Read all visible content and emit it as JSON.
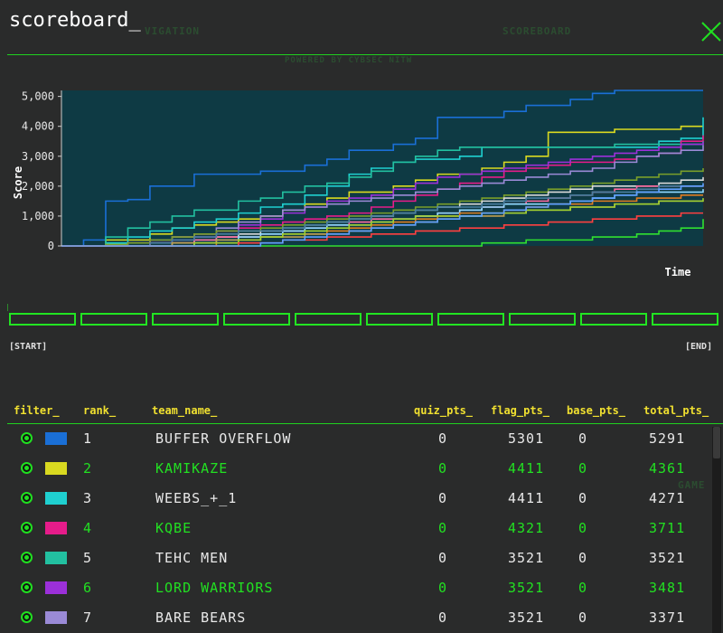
{
  "window": {
    "title": "scoreboard_"
  },
  "background": {
    "nav_label": "VIGATION",
    "scoreboard_label": "SCOREBOARD",
    "powered_by": "POWERED BY CYBSEC NITW",
    "game_label": "GAME"
  },
  "timeline": {
    "start_label": "[START]",
    "end_label": "[END]"
  },
  "chart_data": {
    "type": "line",
    "ylabel": "Score",
    "xlabel": "Time",
    "ylim": [
      0,
      5200
    ],
    "yticks": [
      "0",
      "1,000",
      "2,000",
      "3,000",
      "4,000",
      "5,000"
    ],
    "x_steps": 30,
    "series": [
      {
        "color": "#1a6fd6",
        "values": [
          0,
          200,
          1500,
          1550,
          2000,
          2000,
          2400,
          2400,
          2400,
          2500,
          2500,
          2700,
          2900,
          3200,
          3200,
          3400,
          3600,
          4300,
          4300,
          4300,
          4500,
          4700,
          4700,
          4900,
          5100,
          5200,
          5200,
          5200,
          5200,
          5200
        ]
      },
      {
        "color": "#d9d920",
        "values": [
          0,
          0,
          200,
          200,
          400,
          600,
          700,
          800,
          900,
          1000,
          1200,
          1400,
          1600,
          1800,
          1800,
          2000,
          2200,
          2400,
          2400,
          2600,
          2800,
          3000,
          3800,
          3800,
          3800,
          3900,
          3900,
          3900,
          4000,
          4000
        ]
      },
      {
        "color": "#1fd0d0",
        "values": [
          0,
          0,
          100,
          300,
          500,
          600,
          800,
          900,
          1100,
          1300,
          1400,
          1700,
          2000,
          2400,
          2600,
          2800,
          2900,
          2900,
          3000,
          3300,
          3300,
          3300,
          3300,
          3300,
          3300,
          3300,
          3300,
          3500,
          3600,
          4300
        ]
      },
      {
        "color": "#e61c8a",
        "values": [
          0,
          0,
          0,
          100,
          200,
          300,
          400,
          500,
          600,
          700,
          800,
          900,
          1000,
          1100,
          1300,
          1500,
          1700,
          1900,
          2100,
          2300,
          2500,
          2600,
          2700,
          2800,
          2800,
          2900,
          3000,
          3100,
          3500,
          3700
        ]
      },
      {
        "color": "#22c0a0",
        "values": [
          0,
          0,
          300,
          600,
          800,
          1000,
          1200,
          1200,
          1500,
          1600,
          1800,
          2000,
          2100,
          2300,
          2500,
          2800,
          3000,
          3200,
          3300,
          3300,
          3300,
          3300,
          3300,
          3300,
          3300,
          3400,
          3400,
          3400,
          3400,
          3500
        ]
      },
      {
        "color": "#9b30d9",
        "values": [
          0,
          0,
          0,
          0,
          100,
          200,
          300,
          500,
          700,
          900,
          1100,
          1300,
          1500,
          1600,
          1700,
          1900,
          2100,
          2300,
          2400,
          2500,
          2600,
          2700,
          2800,
          2900,
          3000,
          3100,
          3200,
          3300,
          3400,
          3480
        ]
      },
      {
        "color": "#9a8ad6",
        "values": [
          0,
          0,
          0,
          100,
          200,
          300,
          400,
          600,
          800,
          1000,
          1200,
          1300,
          1400,
          1500,
          1600,
          1700,
          1800,
          1900,
          2000,
          2100,
          2200,
          2300,
          2400,
          2500,
          2600,
          2800,
          3000,
          3100,
          3200,
          3370
        ]
      },
      {
        "color": "#7a9f2a",
        "values": [
          0,
          0,
          50,
          100,
          200,
          300,
          400,
          500,
          500,
          600,
          700,
          800,
          900,
          1000,
          1100,
          1200,
          1300,
          1400,
          1500,
          1600,
          1700,
          1800,
          1900,
          2000,
          2100,
          2200,
          2300,
          2400,
          2500,
          2600
        ]
      },
      {
        "color": "#d9d9d9",
        "values": [
          0,
          0,
          0,
          0,
          0,
          100,
          200,
          300,
          400,
          500,
          600,
          700,
          800,
          900,
          1000,
          1100,
          1200,
          1300,
          1400,
          1500,
          1600,
          1700,
          1800,
          1900,
          2000,
          2000,
          2000,
          2100,
          2200,
          2300
        ]
      },
      {
        "color": "#ff6aa0",
        "values": [
          0,
          0,
          0,
          0,
          100,
          100,
          200,
          300,
          300,
          400,
          500,
          600,
          700,
          800,
          900,
          900,
          1000,
          1100,
          1200,
          1300,
          1400,
          1500,
          1600,
          1700,
          1800,
          1900,
          2000,
          2000,
          2000,
          2000
        ]
      },
      {
        "color": "#8fd9ff",
        "values": [
          0,
          0,
          0,
          0,
          0,
          0,
          100,
          200,
          300,
          400,
          500,
          600,
          700,
          700,
          800,
          900,
          1000,
          1100,
          1200,
          1300,
          1400,
          1400,
          1400,
          1500,
          1600,
          1700,
          1800,
          1800,
          1800,
          1900
        ]
      },
      {
        "color": "#e07d20",
        "values": [
          0,
          0,
          0,
          0,
          0,
          0,
          0,
          100,
          200,
          300,
          400,
          400,
          500,
          600,
          700,
          800,
          900,
          1000,
          1100,
          1100,
          1200,
          1300,
          1400,
          1400,
          1500,
          1500,
          1600,
          1600,
          1700,
          1700
        ]
      },
      {
        "color": "#30e030",
        "values": [
          0,
          0,
          0,
          0,
          0,
          0,
          0,
          0,
          0,
          0,
          0,
          0,
          0,
          0,
          0,
          0,
          0,
          0,
          0,
          100,
          100,
          200,
          200,
          200,
          300,
          300,
          400,
          500,
          600,
          900
        ]
      },
      {
        "color": "#4a7fa0",
        "values": [
          0,
          0,
          0,
          0,
          100,
          200,
          300,
          400,
          500,
          500,
          600,
          700,
          800,
          900,
          1000,
          1100,
          1200,
          1300,
          1300,
          1400,
          1500,
          1600,
          1600,
          1700,
          1800,
          1800,
          1900,
          2000,
          2000,
          2000
        ]
      },
      {
        "color": "#c0a050",
        "values": [
          0,
          0,
          0,
          0,
          0,
          100,
          100,
          200,
          200,
          300,
          300,
          400,
          400,
          500,
          600,
          700,
          800,
          900,
          1000,
          1000,
          1100,
          1200,
          1200,
          1300,
          1300,
          1400,
          1400,
          1500,
          1500,
          1500
        ]
      },
      {
        "color": "#a0d030",
        "values": [
          0,
          0,
          0,
          0,
          0,
          0,
          100,
          100,
          200,
          300,
          400,
          500,
          600,
          700,
          800,
          900,
          1000,
          1000,
          1000,
          1100,
          1100,
          1200,
          1200,
          1300,
          1300,
          1400,
          1400,
          1500,
          1500,
          1600
        ]
      },
      {
        "color": "#ff4040",
        "values": [
          0,
          0,
          0,
          0,
          0,
          0,
          0,
          0,
          100,
          100,
          200,
          200,
          300,
          300,
          400,
          400,
          500,
          500,
          600,
          600,
          700,
          700,
          800,
          800,
          900,
          900,
          1000,
          1000,
          1100,
          1100
        ]
      },
      {
        "color": "#60a0ff",
        "values": [
          0,
          0,
          0,
          0,
          0,
          0,
          0,
          0,
          0,
          100,
          200,
          300,
          400,
          500,
          600,
          700,
          800,
          900,
          1000,
          1100,
          1200,
          1300,
          1400,
          1500,
          1600,
          1700,
          1800,
          1900,
          2000,
          2100
        ]
      }
    ]
  },
  "table": {
    "headers": {
      "filter": "filter_",
      "rank": "rank_",
      "team_name": "team_name_",
      "quiz_pts": "quiz_pts_",
      "flag_pts": "flag_pts_",
      "base_pts": "base_pts_",
      "total_pts": "total_pts_"
    },
    "rows": [
      {
        "rank": "1",
        "team": "BUFFER OVERFLOW",
        "quiz": "0",
        "flag": "5301",
        "base": "0",
        "total": "5291",
        "swatch": "#1a6fd6",
        "text_color": "#e8e8e8"
      },
      {
        "rank": "2",
        "team": "KAMIKAZE",
        "quiz": "0",
        "flag": "4411",
        "base": "0",
        "total": "4361",
        "swatch": "#d9d920",
        "text_color": "#22e022"
      },
      {
        "rank": "3",
        "team": "WEEBS_+_1",
        "quiz": "0",
        "flag": "4411",
        "base": "0",
        "total": "4271",
        "swatch": "#1fd0d0",
        "text_color": "#e8e8e8"
      },
      {
        "rank": "4",
        "team": "KQBE",
        "quiz": "0",
        "flag": "4321",
        "base": "0",
        "total": "3711",
        "swatch": "#e61c8a",
        "text_color": "#22e022"
      },
      {
        "rank": "5",
        "team": "TEHC MEN",
        "quiz": "0",
        "flag": "3521",
        "base": "0",
        "total": "3521",
        "swatch": "#22c0a0",
        "text_color": "#e8e8e8"
      },
      {
        "rank": "6",
        "team": "LORD WARRIORS",
        "quiz": "0",
        "flag": "3521",
        "base": "0",
        "total": "3481",
        "swatch": "#9b30d9",
        "text_color": "#22e022"
      },
      {
        "rank": "7",
        "team": "BARE BEARS",
        "quiz": "0",
        "flag": "3521",
        "base": "0",
        "total": "3371",
        "swatch": "#9a8ad6",
        "text_color": "#e8e8e8"
      }
    ]
  }
}
